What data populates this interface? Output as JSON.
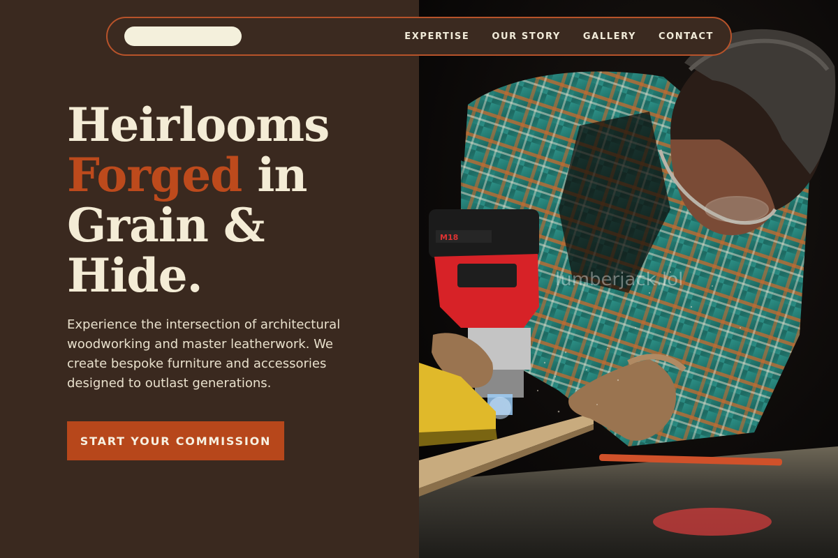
{
  "nav": {
    "links": [
      "EXPERTISE",
      "OUR STORY",
      "GALLERY",
      "CONTACT"
    ]
  },
  "hero": {
    "headline": {
      "line1": "Heirlooms",
      "line2_accent": "Forged",
      "line2_rest": " in",
      "line3": "Grain &",
      "line4": "Hide."
    },
    "lede": "Experience the intersection of architectural woodworking and master leatherwork. We create bespoke furniture and accessories designed to outlast generations.",
    "cta_label": "START YOUR COMMISSION",
    "watermark": "lumberjack.lol"
  },
  "colors": {
    "background": "#3a291f",
    "accent": "#b7471b",
    "text": "#f4ecd6"
  }
}
